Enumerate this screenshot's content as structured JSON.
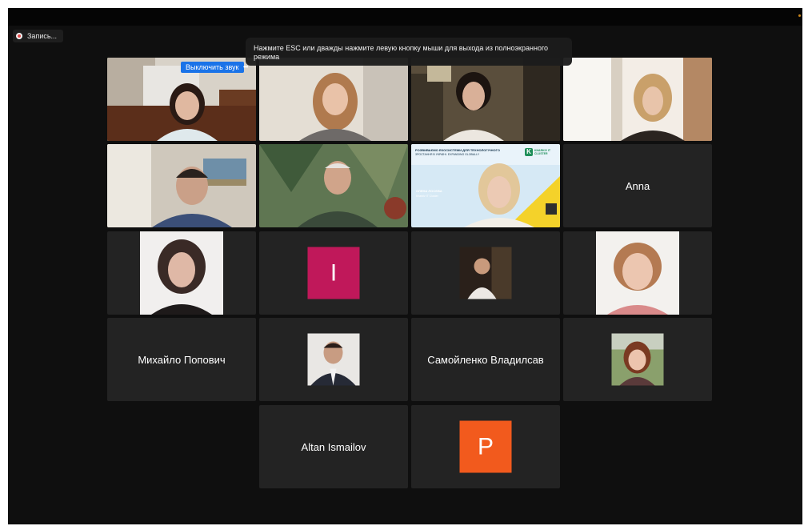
{
  "recording": {
    "label": "Запись..."
  },
  "tooltip": {
    "text": "Нажмите ESC или дважды нажмите левую кнопку мыши для выхода из полноэкранного режима"
  },
  "self_tile": {
    "mute_button_label": "Выключить звук",
    "more_icon": "•••"
  },
  "participants": {
    "anna": "Anna",
    "mykhailo": "Михайло Попович",
    "samoilenko": "Самойленко Владилсав",
    "altan": "Altan Ismailov"
  },
  "avatars": {
    "letter_i": {
      "letter": "I",
      "color": "#c0185a"
    },
    "letter_p": {
      "letter": "P",
      "color": "#f25a1d"
    }
  },
  "slide": {
    "headline": "РОЗВИВАЄМО ЕКОСИСТЕМИ ДЛЯ ТЕХНОЛОГІЧНОГО",
    "subheadline": "ЗРОСТАННЯ В УКРАЇНІ. EXPANDING GLOBALLY",
    "logo_letter": "K",
    "logo_text": "KHARKIV IT CLUSTER",
    "speaker_name": "ОЛЕНА ЛОСЄВА",
    "speaker_role": "Kharkiv IT Cluster"
  },
  "colors": {
    "active_speaker": "#31c24a",
    "mute_button": "#1a73e8"
  }
}
